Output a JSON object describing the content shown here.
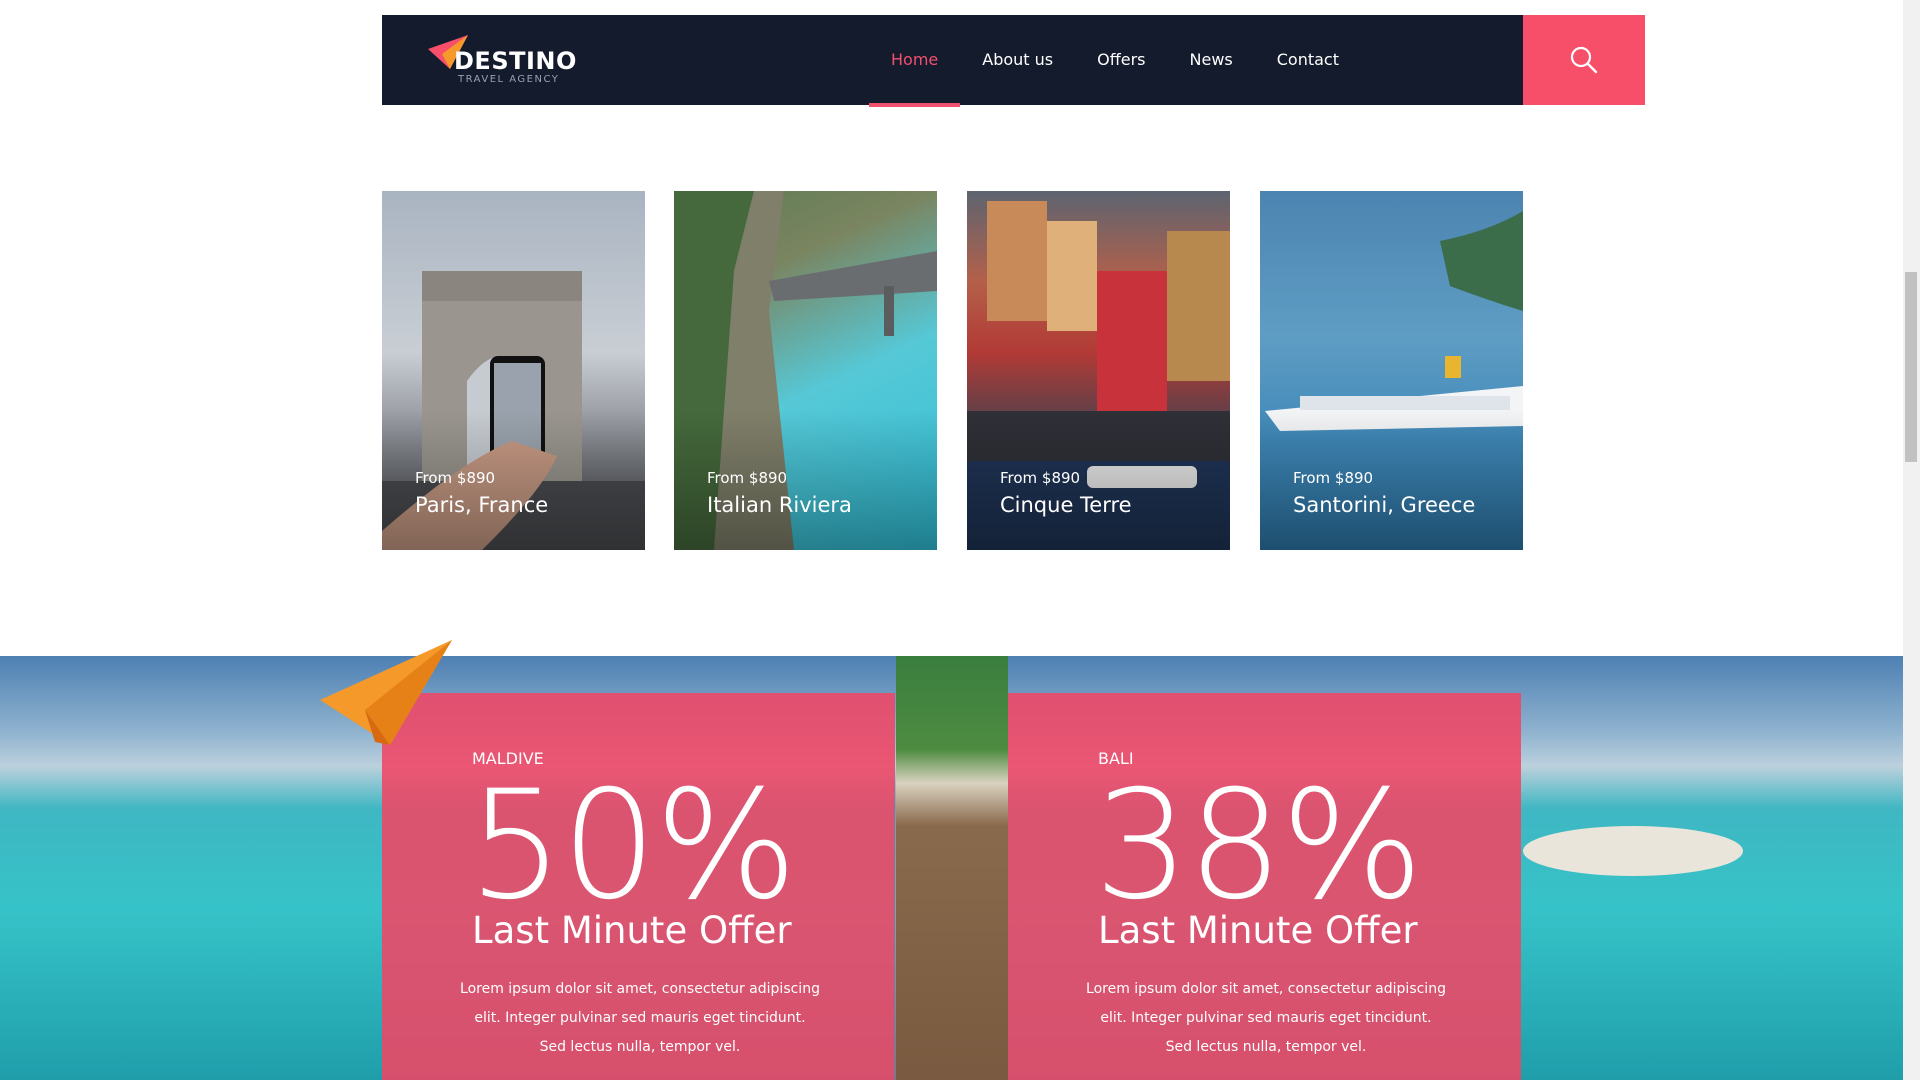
{
  "brand": {
    "name": "DESTINO",
    "tagline": "TRAVEL AGENCY",
    "accent_color": "#f74f6a",
    "header_bg": "#141b2d"
  },
  "nav": {
    "items": [
      {
        "label": "Home",
        "active": true
      },
      {
        "label": "About us",
        "active": false
      },
      {
        "label": "Offers",
        "active": false
      },
      {
        "label": "News",
        "active": false
      },
      {
        "label": "Contact",
        "active": false
      }
    ],
    "search_icon": "search-icon"
  },
  "destinations": [
    {
      "price": "From $890",
      "name": "Paris, France"
    },
    {
      "price": "From $890",
      "name": "Italian Riviera"
    },
    {
      "price": "From $890",
      "name": "Cinque Terre"
    },
    {
      "price": "From $890",
      "name": "Santorini, Greece"
    }
  ],
  "offers": [
    {
      "place": "MALDIVE",
      "discount": "50%",
      "headline": "Last Minute Offer",
      "description": "Lorem ipsum dolor sit amet, consectetur adipiscing elit. Integer pulvinar sed mauris eget tincidunt. Sed lectus nulla, tempor vel."
    },
    {
      "place": "BALI",
      "discount": "38%",
      "headline": "Last Minute Offer",
      "description": "Lorem ipsum dolor sit amet, consectetur adipiscing elit. Integer pulvinar sed mauris eget tincidunt. Sed lectus nulla, tempor vel."
    }
  ]
}
